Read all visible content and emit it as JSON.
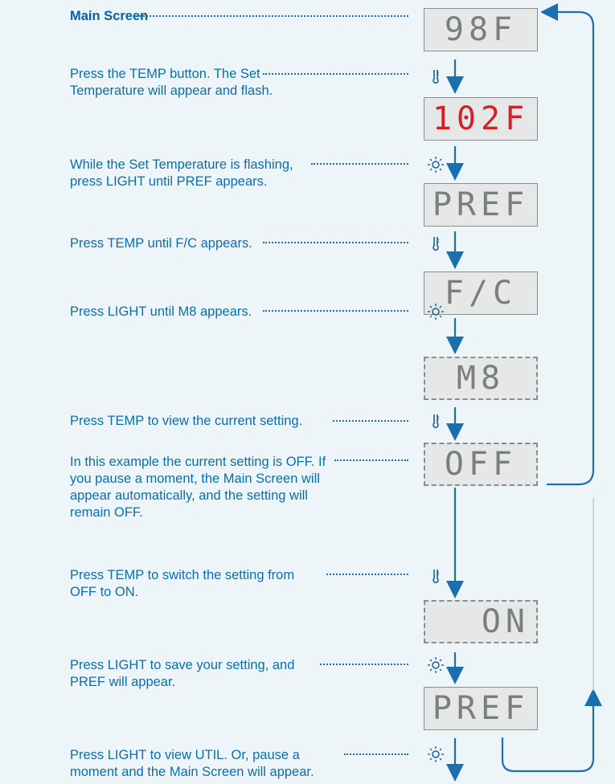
{
  "steps": [
    {
      "text": "Main Screen"
    },
    {
      "text": "Press the TEMP button. The Set Temperature will appear and flash."
    },
    {
      "text": "While the Set Temperature is flashing, press LIGHT until PREF appears."
    },
    {
      "text": "Press TEMP until F/C appears."
    },
    {
      "text": "Press LIGHT until M8 appears."
    },
    {
      "text": "Press TEMP to view the current setting."
    },
    {
      "text": "In this example the current setting is OFF. If you pause a moment, the Main Screen will appear automatically, and the setting will remain OFF."
    },
    {
      "text": "Press TEMP to switch the setting from OFF to ON."
    },
    {
      "text": "Press LIGHT to save your setting, and PREF will appear."
    },
    {
      "text": "Press LIGHT to view UTIL. Or, pause a moment and the Main Screen will appear."
    }
  ],
  "displays": [
    {
      "text": "98F",
      "style": "normal"
    },
    {
      "text": "102F",
      "style": "red"
    },
    {
      "text": "PREF",
      "style": "normal"
    },
    {
      "text": "F/C",
      "style": "normal"
    },
    {
      "text": "M8",
      "style": "dashed"
    },
    {
      "text": "OFF",
      "style": "dashed"
    },
    {
      "text": "ON",
      "style": "dashed"
    },
    {
      "text": "PREF",
      "style": "normal"
    }
  ],
  "icons": [
    "thermometer-icon",
    "sun-icon"
  ],
  "colors": {
    "text": "#0a6eac",
    "arrow": "#1a6fb0",
    "lcd_red": "#d61f26",
    "lcd_gray": "#7a7e81"
  }
}
